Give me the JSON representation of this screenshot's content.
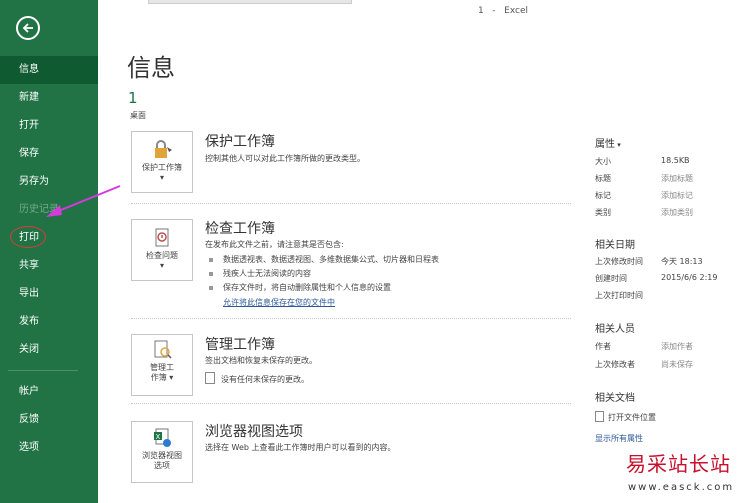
{
  "window": {
    "title": "1   -   Excel"
  },
  "sidebar": {
    "items": [
      {
        "label": "信息",
        "state": "active"
      },
      {
        "label": "新建",
        "state": "normal"
      },
      {
        "label": "打开",
        "state": "normal"
      },
      {
        "label": "保存",
        "state": "normal"
      },
      {
        "label": "另存为",
        "state": "normal"
      },
      {
        "label": "历史记录",
        "state": "disabled"
      },
      {
        "label": "打印",
        "state": "normal"
      },
      {
        "label": "共享",
        "state": "normal"
      },
      {
        "label": "导出",
        "state": "normal"
      },
      {
        "label": "发布",
        "state": "normal"
      },
      {
        "label": "关闭",
        "state": "normal"
      },
      {
        "label": "帐户",
        "state": "normal"
      },
      {
        "label": "反馈",
        "state": "normal"
      },
      {
        "label": "选项",
        "state": "normal"
      }
    ],
    "accent_color": "#217346"
  },
  "main": {
    "heading": "信息",
    "file_name": "1",
    "file_location": "桌面",
    "protect": {
      "button_label": "保护工作簿",
      "title": "保护工作簿",
      "desc": "控制其他人可以对此工作簿所做的更改类型。"
    },
    "inspect": {
      "button_label": "检查问题",
      "title": "检查工作簿",
      "desc": "在发布此文件之前，请注意其是否包含:",
      "bullets": [
        "数据透视表、数据透视图、多维数据集公式、切片器和日程表",
        "残疾人士无法阅读的内容",
        "保存文件时，将自动删除属性和个人信息的设置"
      ],
      "link": "允许将此信息保存在您的文件中"
    },
    "manage": {
      "button_label_1": "管理工",
      "button_label_2": "作簿",
      "title": "管理工作簿",
      "desc": "签出文档和恢复未保存的更改。",
      "none_text": "没有任何未保存的更改。"
    },
    "browser": {
      "button_label_1": "浏览器视图",
      "button_label_2": "选项",
      "title": "浏览器视图选项",
      "desc": "选择在 Web 上查看此工作簿时用户可以看到的内容。"
    }
  },
  "properties": {
    "heading": "属性",
    "rows": [
      {
        "key": "大小",
        "value": "18.5KB",
        "placeholder": false
      },
      {
        "key": "标题",
        "value": "添加标题",
        "placeholder": true
      },
      {
        "key": "标记",
        "value": "添加标记",
        "placeholder": true
      },
      {
        "key": "类别",
        "value": "添加类别",
        "placeholder": true
      }
    ],
    "dates_heading": "相关日期",
    "dates": [
      {
        "key": "上次修改时间",
        "value": "今天 18:13"
      },
      {
        "key": "创建时间",
        "value": "2015/6/6 2:19"
      },
      {
        "key": "上次打印时间",
        "value": ""
      }
    ],
    "people_heading": "相关人员",
    "people": [
      {
        "key": "作者",
        "value": "添加作者"
      },
      {
        "key": "上次修改者",
        "value": "尚未保存"
      }
    ],
    "docs_heading": "相关文档",
    "open_location": "打开文件位置",
    "show_all": "显示所有属性"
  },
  "watermark": {
    "text": "易采站长站",
    "url": "www.easck.com"
  }
}
